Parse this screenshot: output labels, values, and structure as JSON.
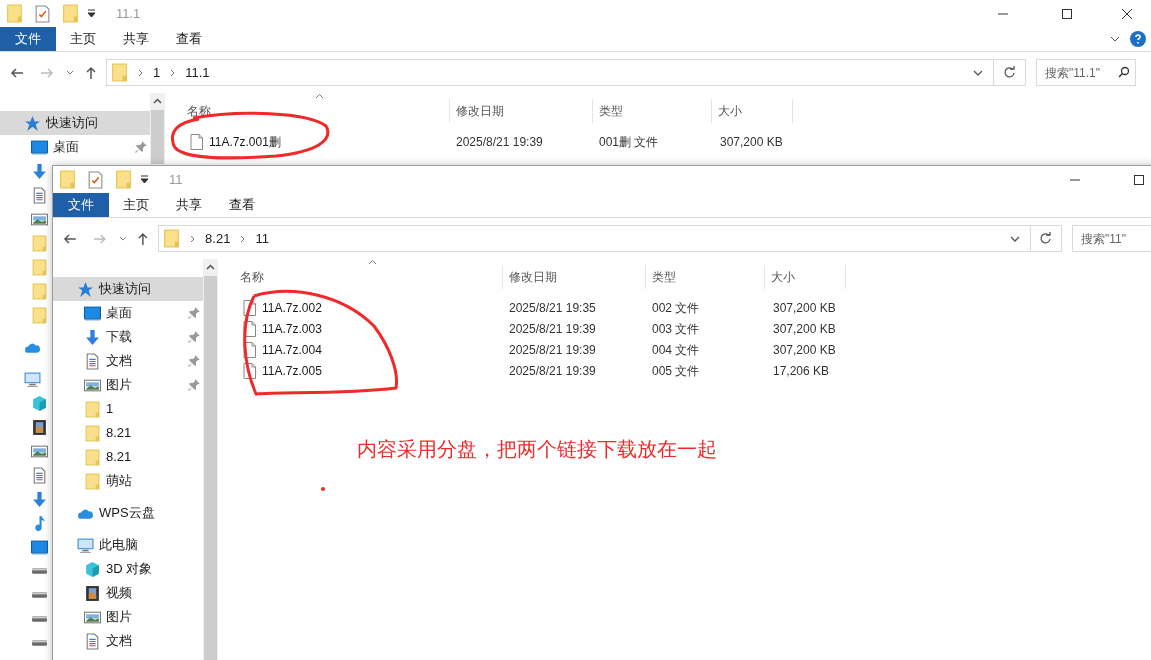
{
  "windows": [
    {
      "title": "11.1",
      "help": true,
      "ribbon_tabs": [
        {
          "label": "文件",
          "selected": true
        },
        {
          "label": "主页",
          "selected": false
        },
        {
          "label": "共享",
          "selected": false
        },
        {
          "label": "查看",
          "selected": false
        }
      ],
      "breadcrumb": [
        "1",
        "11.1"
      ],
      "search": {
        "placeholder": "搜索\"11.1\""
      },
      "columns": [
        "名称",
        "修改日期",
        "类型",
        "大小"
      ],
      "files": [
        {
          "name": "11A.7z.001删",
          "modified": "2025/8/21 19:39",
          "type": "001删 文件",
          "size": "307,200 KB"
        }
      ],
      "nav": [
        {
          "kind": "star",
          "label": "快速访问",
          "selected": true,
          "pinned": false,
          "children": [
            {
              "kind": "desktop",
              "label": "桌面",
              "selected": false,
              "pinned": true
            },
            {
              "kind": "download"
            },
            {
              "kind": "document"
            },
            {
              "kind": "image"
            },
            {
              "kind": "folder"
            },
            {
              "kind": "folder"
            },
            {
              "kind": "folder"
            },
            {
              "kind": "folder"
            }
          ]
        },
        {
          "kind": "cloud"
        },
        {
          "kind": "pc",
          "children": [
            {
              "kind": "cube"
            },
            {
              "kind": "video"
            },
            {
              "kind": "image"
            },
            {
              "kind": "document"
            },
            {
              "kind": "download"
            },
            {
              "kind": "music"
            },
            {
              "kind": "desktop"
            },
            {
              "kind": "drive"
            },
            {
              "kind": "drive"
            },
            {
              "kind": "drive"
            },
            {
              "kind": "drive"
            }
          ]
        }
      ]
    },
    {
      "title": "11",
      "help": false,
      "ribbon_tabs": [
        {
          "label": "文件",
          "selected": true
        },
        {
          "label": "主页",
          "selected": false
        },
        {
          "label": "共享",
          "selected": false
        },
        {
          "label": "查看",
          "selected": false
        }
      ],
      "breadcrumb": [
        "8.21",
        "11"
      ],
      "search": {
        "placeholder": "搜索\"11\""
      },
      "columns": [
        "名称",
        "修改日期",
        "类型",
        "大小"
      ],
      "files": [
        {
          "name": "11A.7z.002",
          "modified": "2025/8/21 19:35",
          "type": "002 文件",
          "size": "307,200 KB"
        },
        {
          "name": "11A.7z.003",
          "modified": "2025/8/21 19:39",
          "type": "003 文件",
          "size": "307,200 KB"
        },
        {
          "name": "11A.7z.004",
          "modified": "2025/8/21 19:39",
          "type": "004 文件",
          "size": "307,200 KB"
        },
        {
          "name": "11A.7z.005",
          "modified": "2025/8/21 19:39",
          "type": "005 文件",
          "size": "17,206 KB"
        }
      ],
      "nav": [
        {
          "kind": "star",
          "label": "快速访问",
          "selected": true,
          "pinned": false,
          "children": [
            {
              "kind": "desktop",
              "label": "桌面",
              "selected": false,
              "pinned": true
            },
            {
              "kind": "download",
              "label": "下载",
              "selected": false,
              "pinned": true
            },
            {
              "kind": "document",
              "label": "文档",
              "selected": false,
              "pinned": true
            },
            {
              "kind": "image",
              "label": "图片",
              "selected": false,
              "pinned": true
            },
            {
              "kind": "folder",
              "label": "1",
              "selected": false,
              "pinned": false
            },
            {
              "kind": "folder",
              "label": "8.21",
              "selected": false,
              "pinned": false
            },
            {
              "kind": "folder",
              "label": "8.21",
              "selected": false,
              "pinned": false
            },
            {
              "kind": "folder",
              "label": "萌站",
              "selected": false,
              "pinned": false
            }
          ]
        },
        {
          "kind": "cloud",
          "label": "WPS云盘",
          "selected": false,
          "pinned": false
        },
        {
          "kind": "pc",
          "label": "此电脑",
          "selected": false,
          "pinned": false,
          "children": [
            {
              "kind": "cube",
              "label": "3D 对象",
              "selected": false,
              "pinned": false
            },
            {
              "kind": "video",
              "label": "视频",
              "selected": false,
              "pinned": false
            },
            {
              "kind": "image",
              "label": "图片",
              "selected": false,
              "pinned": false
            },
            {
              "kind": "document",
              "label": "文档",
              "selected": false,
              "pinned": false
            }
          ]
        }
      ]
    }
  ],
  "annotation": {
    "note": "内容采用分盘，把两个链接下载放在一起"
  }
}
